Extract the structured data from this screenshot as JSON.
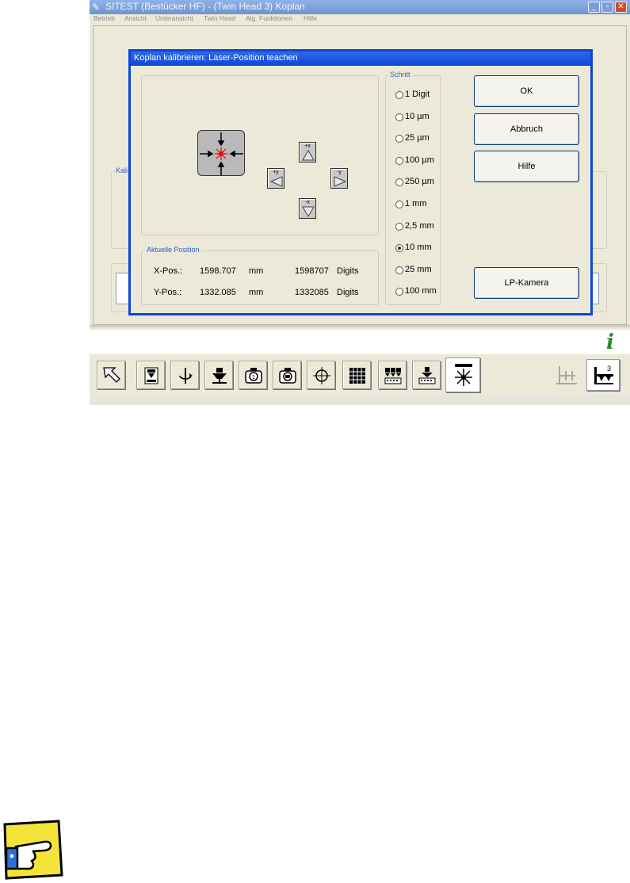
{
  "window": {
    "title": "SITEST (Bestücker HF) - (Twin Head 3) Koplan",
    "menu": [
      "Betrieb",
      "Ansicht",
      "Unteransicht",
      "Twin Head",
      "Alg. Funktionen",
      "Hilfe"
    ],
    "background_group_label": "Kali"
  },
  "dialog": {
    "title": "Koplan kalibrieren: Laser-Position teachen",
    "jog": {
      "plus_x": "+x",
      "minus_x": "-x",
      "plus_y": "+y",
      "minus_y": "-y"
    },
    "position": {
      "group_label": "Aktuelle Position",
      "x_label": "X-Pos.:",
      "x_mm": "1598.707",
      "x_mm_unit": "mm",
      "x_digits": "1598707",
      "x_digits_unit": "Digits",
      "y_label": "Y-Pos.:",
      "y_mm": "1332.085",
      "y_mm_unit": "mm",
      "y_digits": "1332085",
      "y_digits_unit": "Digits"
    },
    "step": {
      "group_label": "Schritt",
      "options": [
        "1 Digit",
        "10 µm",
        "25 µm",
        "100 µm",
        "250 µm",
        "1 mm",
        "2,5 mm",
        "10 mm",
        "25 mm",
        "100 mm"
      ],
      "selected": "10 mm"
    },
    "buttons": {
      "ok": "OK",
      "cancel": "Abbruch",
      "help": "Hilfe",
      "camera": "LP-Kamera"
    }
  },
  "toolbar": {
    "tools": [
      "pointer-icon",
      "load-board-icon",
      "rotate-axis-icon",
      "nozzle-icon",
      "camera-1-icon",
      "camera-2-icon",
      "crosshair-icon",
      "grid-icon",
      "feeder-array-icon",
      "feeder-icon",
      "laser-icon"
    ],
    "active_tool": "laser-icon",
    "right_tools": [
      "feeder-disabled-icon",
      "twin-head-3-icon"
    ],
    "twin_head_number": "3"
  },
  "info_icon": "i"
}
